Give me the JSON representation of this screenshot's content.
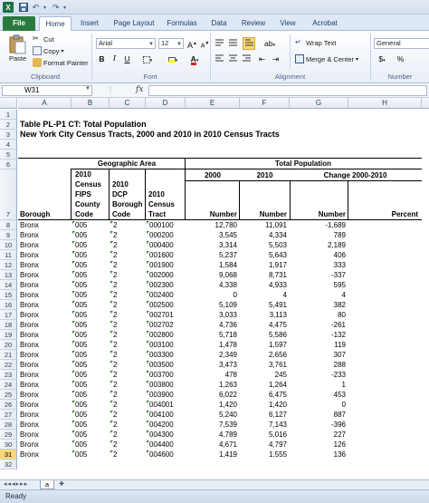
{
  "window": {
    "logo": "X"
  },
  "quick_access": {
    "save_icon": "save-icon",
    "undo_icon": "undo-icon",
    "redo_icon": "redo-icon"
  },
  "tabs": [
    "File",
    "Home",
    "Insert",
    "Page Layout",
    "Formulas",
    "Data",
    "Review",
    "View",
    "Acrobat"
  ],
  "ribbon": {
    "clipboard": {
      "label": "Clipboard",
      "paste": "Paste",
      "cut": "Cut",
      "copy": "Copy",
      "format_painter": "Format Painter"
    },
    "font": {
      "label": "Font",
      "name": "Arial",
      "size": "12",
      "bold": "B",
      "italic": "I",
      "underline": "U"
    },
    "alignment": {
      "label": "Alignment",
      "wrap": "Wrap Text",
      "merge": "Merge & Center"
    },
    "number": {
      "label": "Number",
      "format": "General",
      "currency": "$",
      "percent": "%"
    }
  },
  "formula_bar": {
    "name_box": "W31",
    "fx": "fx",
    "value": ""
  },
  "columns": [
    "A",
    "B",
    "C",
    "D",
    "E",
    "F",
    "G",
    "H"
  ],
  "sheet": {
    "title1": "Table PL-P1 CT:  Total Population",
    "title2": "New York City Census Tracts, 2000 and 2010 in 2010 Census Tracts",
    "geo_header": "Geographic Area",
    "pop_header": "Total Population",
    "h_2000": "2000",
    "h_2010": "2010",
    "h_change": "Change 2000-2010",
    "h_borough": "Borough",
    "h_fips": [
      "2010",
      "Census",
      "FIPS",
      "County",
      "Code"
    ],
    "h_dcp": [
      "2010",
      "DCP",
      "Borough",
      "Code"
    ],
    "h_tract": [
      "2010",
      "Census",
      "Tract"
    ],
    "h_number": "Number",
    "h_percent": "Percent"
  },
  "rows": [
    [
      "Bronx",
      "005",
      "2",
      "000100",
      "12,780",
      "11,091",
      "-1,689"
    ],
    [
      "Bronx",
      "005",
      "2",
      "000200",
      "3,545",
      "4,334",
      "789"
    ],
    [
      "Bronx",
      "005",
      "2",
      "000400",
      "3,314",
      "5,503",
      "2,189"
    ],
    [
      "Bronx",
      "005",
      "2",
      "001600",
      "5,237",
      "5,643",
      "406"
    ],
    [
      "Bronx",
      "005",
      "2",
      "001900",
      "1,584",
      "1,917",
      "333"
    ],
    [
      "Bronx",
      "005",
      "2",
      "002000",
      "9,068",
      "8,731",
      "-337"
    ],
    [
      "Bronx",
      "005",
      "2",
      "002300",
      "4,338",
      "4,933",
      "595"
    ],
    [
      "Bronx",
      "005",
      "2",
      "002400",
      "0",
      "4",
      "4"
    ],
    [
      "Bronx",
      "005",
      "2",
      "002500",
      "5,109",
      "5,491",
      "382"
    ],
    [
      "Bronx",
      "005",
      "2",
      "002701",
      "3,033",
      "3,113",
      "80"
    ],
    [
      "Bronx",
      "005",
      "2",
      "002702",
      "4,736",
      "4,475",
      "-261"
    ],
    [
      "Bronx",
      "005",
      "2",
      "002800",
      "5,718",
      "5,586",
      "-132"
    ],
    [
      "Bronx",
      "005",
      "2",
      "003100",
      "1,478",
      "1,597",
      "119"
    ],
    [
      "Bronx",
      "005",
      "2",
      "003300",
      "2,349",
      "2,656",
      "307"
    ],
    [
      "Bronx",
      "005",
      "2",
      "003500",
      "3,473",
      "3,761",
      "288"
    ],
    [
      "Bronx",
      "005",
      "2",
      "003700",
      "478",
      "245",
      "-233"
    ],
    [
      "Bronx",
      "005",
      "2",
      "003800",
      "1,263",
      "1,264",
      "1"
    ],
    [
      "Bronx",
      "005",
      "2",
      "003900",
      "6,022",
      "6,475",
      "453"
    ],
    [
      "Bronx",
      "005",
      "2",
      "004001",
      "1,420",
      "1,420",
      "0"
    ],
    [
      "Bronx",
      "005",
      "2",
      "004100",
      "5,240",
      "6,127",
      "887"
    ],
    [
      "Bronx",
      "005",
      "2",
      "004200",
      "7,539",
      "7,143",
      "-396"
    ],
    [
      "Bronx",
      "005",
      "2",
      "004300",
      "4,789",
      "5,016",
      "227"
    ],
    [
      "Bronx",
      "005",
      "2",
      "004400",
      "4,671",
      "4,797",
      "126"
    ],
    [
      "Bronx",
      "005",
      "2",
      "004600",
      "1,419",
      "1,555",
      "136"
    ]
  ],
  "row_numbers": [
    "1",
    "2",
    "3",
    "4",
    "5",
    "6",
    "7",
    "8",
    "9",
    "10",
    "11",
    "12",
    "13",
    "14",
    "15",
    "16",
    "17",
    "18",
    "19",
    "20",
    "21",
    "22",
    "23",
    "24",
    "25",
    "26",
    "27",
    "28",
    "29",
    "30",
    "31",
    "32"
  ],
  "selected_row": "31",
  "sheet_tab": "a",
  "status": {
    "text": "Ready"
  }
}
